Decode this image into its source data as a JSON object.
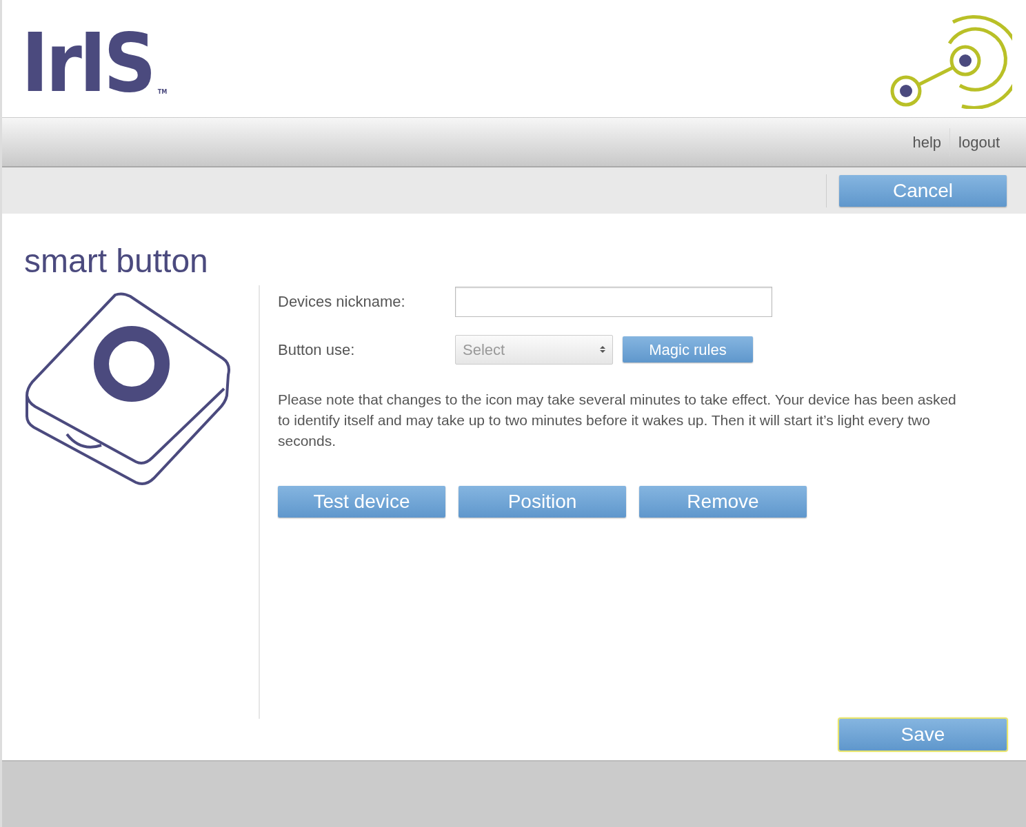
{
  "header": {
    "logo_text": "IrIS",
    "logo_mark": "TM"
  },
  "nav": {
    "links": [
      "help",
      "logout"
    ]
  },
  "toolbar": {
    "buttons": [
      {
        "label": "Cancel",
        "focused": false
      }
    ]
  },
  "device": {
    "title": "smart button"
  },
  "form": {
    "fields": [
      {
        "kind": "text",
        "label": "Devices nickname:"
      },
      {
        "kind": "select",
        "label": "Button use:",
        "placeholder": "Select",
        "action": "Magic rules"
      }
    ],
    "note": "Please note that changes to the icon may take several minutes to take effect. Your device has been asked to identify itself and may take up to two minutes before it wakes up. Then it will start it’s light every two seconds.",
    "buttons": [
      "Test device",
      "Position",
      "Remove"
    ]
  },
  "footer_buttons": [
    {
      "label": "Save",
      "focused": true
    }
  ]
}
